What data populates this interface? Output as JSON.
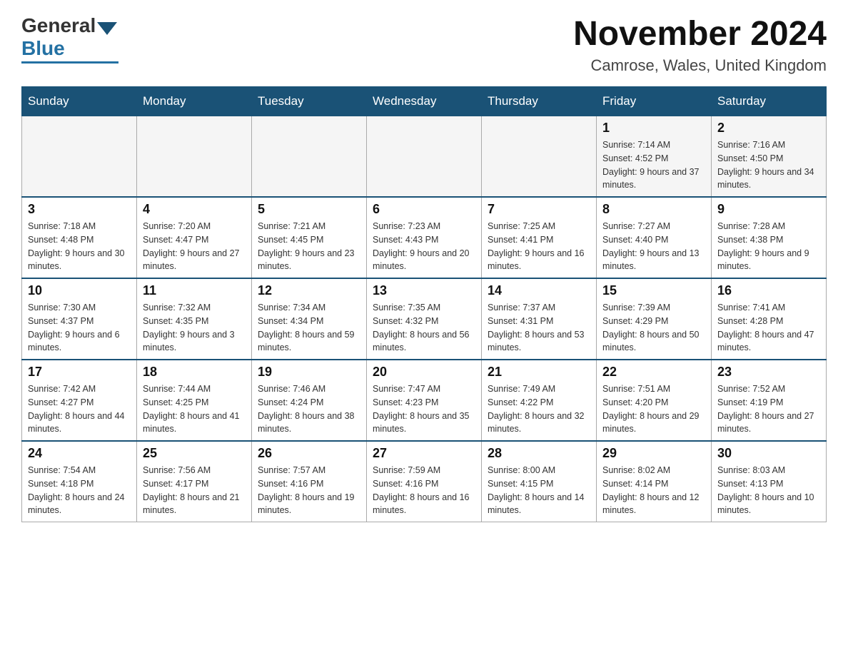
{
  "header": {
    "logo": {
      "general": "General",
      "blue": "Blue"
    },
    "title": "November 2024",
    "subtitle": "Camrose, Wales, United Kingdom"
  },
  "weekdays": [
    "Sunday",
    "Monday",
    "Tuesday",
    "Wednesday",
    "Thursday",
    "Friday",
    "Saturday"
  ],
  "weeks": [
    [
      {
        "day": "",
        "info": ""
      },
      {
        "day": "",
        "info": ""
      },
      {
        "day": "",
        "info": ""
      },
      {
        "day": "",
        "info": ""
      },
      {
        "day": "",
        "info": ""
      },
      {
        "day": "1",
        "info": "Sunrise: 7:14 AM\nSunset: 4:52 PM\nDaylight: 9 hours and 37 minutes."
      },
      {
        "day": "2",
        "info": "Sunrise: 7:16 AM\nSunset: 4:50 PM\nDaylight: 9 hours and 34 minutes."
      }
    ],
    [
      {
        "day": "3",
        "info": "Sunrise: 7:18 AM\nSunset: 4:48 PM\nDaylight: 9 hours and 30 minutes."
      },
      {
        "day": "4",
        "info": "Sunrise: 7:20 AM\nSunset: 4:47 PM\nDaylight: 9 hours and 27 minutes."
      },
      {
        "day": "5",
        "info": "Sunrise: 7:21 AM\nSunset: 4:45 PM\nDaylight: 9 hours and 23 minutes."
      },
      {
        "day": "6",
        "info": "Sunrise: 7:23 AM\nSunset: 4:43 PM\nDaylight: 9 hours and 20 minutes."
      },
      {
        "day": "7",
        "info": "Sunrise: 7:25 AM\nSunset: 4:41 PM\nDaylight: 9 hours and 16 minutes."
      },
      {
        "day": "8",
        "info": "Sunrise: 7:27 AM\nSunset: 4:40 PM\nDaylight: 9 hours and 13 minutes."
      },
      {
        "day": "9",
        "info": "Sunrise: 7:28 AM\nSunset: 4:38 PM\nDaylight: 9 hours and 9 minutes."
      }
    ],
    [
      {
        "day": "10",
        "info": "Sunrise: 7:30 AM\nSunset: 4:37 PM\nDaylight: 9 hours and 6 minutes."
      },
      {
        "day": "11",
        "info": "Sunrise: 7:32 AM\nSunset: 4:35 PM\nDaylight: 9 hours and 3 minutes."
      },
      {
        "day": "12",
        "info": "Sunrise: 7:34 AM\nSunset: 4:34 PM\nDaylight: 8 hours and 59 minutes."
      },
      {
        "day": "13",
        "info": "Sunrise: 7:35 AM\nSunset: 4:32 PM\nDaylight: 8 hours and 56 minutes."
      },
      {
        "day": "14",
        "info": "Sunrise: 7:37 AM\nSunset: 4:31 PM\nDaylight: 8 hours and 53 minutes."
      },
      {
        "day": "15",
        "info": "Sunrise: 7:39 AM\nSunset: 4:29 PM\nDaylight: 8 hours and 50 minutes."
      },
      {
        "day": "16",
        "info": "Sunrise: 7:41 AM\nSunset: 4:28 PM\nDaylight: 8 hours and 47 minutes."
      }
    ],
    [
      {
        "day": "17",
        "info": "Sunrise: 7:42 AM\nSunset: 4:27 PM\nDaylight: 8 hours and 44 minutes."
      },
      {
        "day": "18",
        "info": "Sunrise: 7:44 AM\nSunset: 4:25 PM\nDaylight: 8 hours and 41 minutes."
      },
      {
        "day": "19",
        "info": "Sunrise: 7:46 AM\nSunset: 4:24 PM\nDaylight: 8 hours and 38 minutes."
      },
      {
        "day": "20",
        "info": "Sunrise: 7:47 AM\nSunset: 4:23 PM\nDaylight: 8 hours and 35 minutes."
      },
      {
        "day": "21",
        "info": "Sunrise: 7:49 AM\nSunset: 4:22 PM\nDaylight: 8 hours and 32 minutes."
      },
      {
        "day": "22",
        "info": "Sunrise: 7:51 AM\nSunset: 4:20 PM\nDaylight: 8 hours and 29 minutes."
      },
      {
        "day": "23",
        "info": "Sunrise: 7:52 AM\nSunset: 4:19 PM\nDaylight: 8 hours and 27 minutes."
      }
    ],
    [
      {
        "day": "24",
        "info": "Sunrise: 7:54 AM\nSunset: 4:18 PM\nDaylight: 8 hours and 24 minutes."
      },
      {
        "day": "25",
        "info": "Sunrise: 7:56 AM\nSunset: 4:17 PM\nDaylight: 8 hours and 21 minutes."
      },
      {
        "day": "26",
        "info": "Sunrise: 7:57 AM\nSunset: 4:16 PM\nDaylight: 8 hours and 19 minutes."
      },
      {
        "day": "27",
        "info": "Sunrise: 7:59 AM\nSunset: 4:16 PM\nDaylight: 8 hours and 16 minutes."
      },
      {
        "day": "28",
        "info": "Sunrise: 8:00 AM\nSunset: 4:15 PM\nDaylight: 8 hours and 14 minutes."
      },
      {
        "day": "29",
        "info": "Sunrise: 8:02 AM\nSunset: 4:14 PM\nDaylight: 8 hours and 12 minutes."
      },
      {
        "day": "30",
        "info": "Sunrise: 8:03 AM\nSunset: 4:13 PM\nDaylight: 8 hours and 10 minutes."
      }
    ]
  ]
}
